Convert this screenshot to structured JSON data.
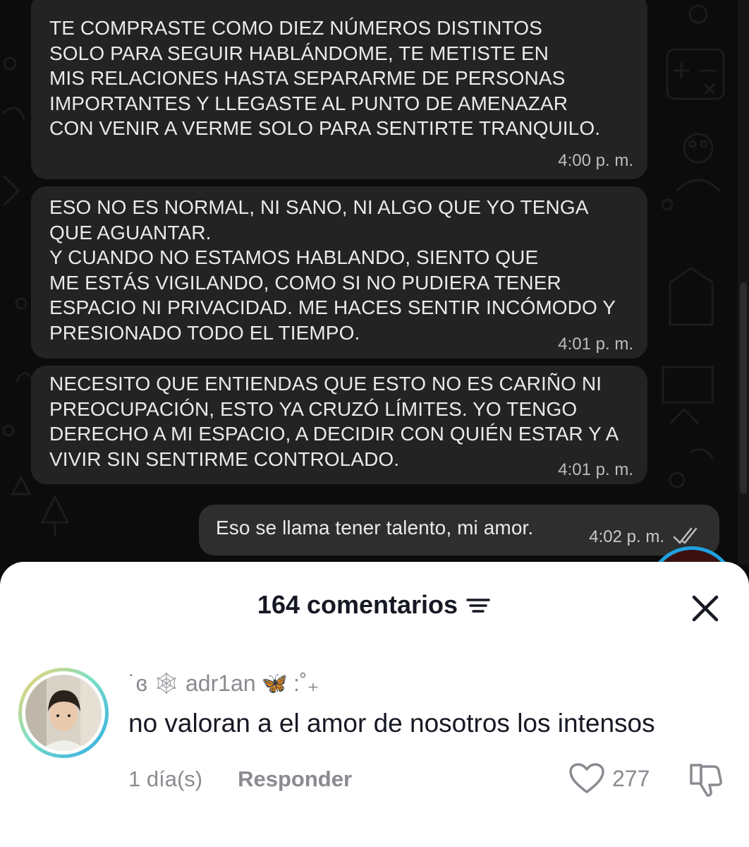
{
  "chat": {
    "messages": [
      {
        "text": "TE COMPRASTE COMO DIEZ NÚMEROS DISTINTOS\nSOLO PARA SEGUIR HABLÁNDOME, TE METISTE EN\nMIS RELACIONES HASTA SEPARARME DE PERSONAS\nIMPORTANTES Y LLEGASTE AL PUNTO DE AMENAZAR\nCON VENIR A VERME SOLO PARA SENTIRTE TRANQUILO.",
        "time": "4:00 p. m."
      },
      {
        "text": "ESO NO ES NORMAL, NI SANO, NI ALGO QUE YO TENGA\nQUE AGUANTAR.\nY CUANDO NO ESTAMOS HABLANDO, SIENTO QUE\nME ESTÁS VIGILANDO, COMO SI NO PUDIERA TENER\nESPACIO NI PRIVACIDAD. ME HACES SENTIR INCÓMODO Y\nPRESIONADO TODO EL TIEMPO.",
        "time": "4:01 p. m."
      },
      {
        "text": "NECESITO QUE ENTIENDAS QUE ESTO NO ES CARIÑO NI\nPREOCUPACIÓN, ESTO YA CRUZÓ LÍMITES. YO TENGO\nDERECHO A MI ESPACIO, A DECIDIR CON QUIÉN ESTAR Y A\nVIVIR SIN SENTIRME CONTROLADO.",
        "time": "4:01 p. m."
      }
    ],
    "outgoing": {
      "text": "Eso se llama tener talento, mi amor.",
      "time": "4:02 p. m.",
      "status_icon": "double-check-icon"
    }
  },
  "comments_sheet": {
    "count_label": "164 comentarios",
    "filter_icon": "filter-icon",
    "close_icon": "close-icon",
    "comment": {
      "prefix": "˙ɞ",
      "web_glyph": "🕸",
      "username": "adr1an",
      "butterfly_glyph": "🦋",
      "suffix": ":˚₊",
      "text": "no valoran a el amor de nosotros los intensos",
      "date": "1 día(s)",
      "reply_label": "Responder",
      "likes": "277"
    }
  },
  "colors": {
    "chat_bg": "#0c0c0c",
    "bubble_in": "#232323",
    "bubble_out": "#2e2e2e",
    "sheet_bg": "#ffffff",
    "text_primary": "#161823",
    "text_secondary": "#8a8b91",
    "avatar_ring": "#2aa8e8"
  }
}
